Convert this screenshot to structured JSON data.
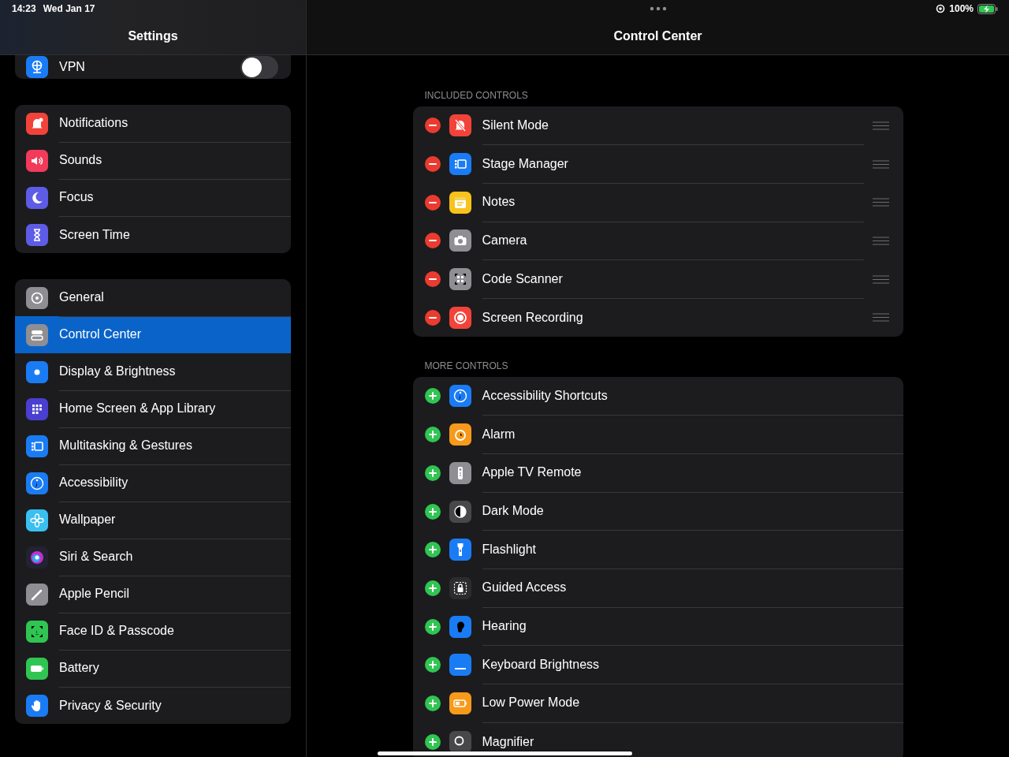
{
  "status_bar": {
    "time": "14:23",
    "date": "Wed Jan 17",
    "battery_percent": "100%",
    "charging": true
  },
  "sidebar": {
    "title": "Settings",
    "groups": [
      {
        "items": [
          {
            "label": "VPN",
            "color": "#1a7cf5",
            "kind": "toggle",
            "on": false,
            "selected": false
          }
        ]
      },
      {
        "items": [
          {
            "label": "Notifications",
            "color": "#f2433a",
            "kind": "link",
            "selected": false
          },
          {
            "label": "Sounds",
            "color": "#f23a5a",
            "kind": "link",
            "selected": false
          },
          {
            "label": "Focus",
            "color": "#5e5ce6",
            "kind": "link",
            "selected": false
          },
          {
            "label": "Screen Time",
            "color": "#5e5ce6",
            "kind": "link",
            "selected": false
          }
        ]
      },
      {
        "items": [
          {
            "label": "General",
            "color": "#8e8e93",
            "kind": "link",
            "selected": false
          },
          {
            "label": "Control Center",
            "color": "#8e8e93",
            "kind": "link",
            "selected": true
          },
          {
            "label": "Display & Brightness",
            "color": "#1a7cf5",
            "kind": "link",
            "selected": false
          },
          {
            "label": "Home Screen & App Library",
            "color": "#4a3fd0",
            "kind": "link",
            "selected": false
          },
          {
            "label": "Multitasking & Gestures",
            "color": "#1a7cf5",
            "kind": "link",
            "selected": false
          },
          {
            "label": "Accessibility",
            "color": "#1a7cf5",
            "kind": "link",
            "selected": false
          },
          {
            "label": "Wallpaper",
            "color": "#3ac0f0",
            "kind": "link",
            "selected": false
          },
          {
            "label": "Siri & Search",
            "color": "#222233",
            "kind": "link",
            "selected": false
          },
          {
            "label": "Apple Pencil",
            "color": "#8e8e93",
            "kind": "link",
            "selected": false
          },
          {
            "label": "Face ID & Passcode",
            "color": "#30c552",
            "kind": "link",
            "selected": false
          },
          {
            "label": "Battery",
            "color": "#30c552",
            "kind": "link",
            "selected": false
          },
          {
            "label": "Privacy & Security",
            "color": "#1a7cf5",
            "kind": "link",
            "selected": false
          }
        ]
      }
    ]
  },
  "detail": {
    "title": "Control Center",
    "sections": [
      {
        "header": "INCLUDED CONTROLS",
        "kind": "remove",
        "items": [
          {
            "label": "Silent Mode",
            "color": "#f2433a"
          },
          {
            "label": "Stage Manager",
            "color": "#1a7cf5"
          },
          {
            "label": "Notes",
            "color": "#f7c21b"
          },
          {
            "label": "Camera",
            "color": "#8e8e93"
          },
          {
            "label": "Code Scanner",
            "color": "#8e8e93"
          },
          {
            "label": "Screen Recording",
            "color": "#f2433a"
          }
        ]
      },
      {
        "header": "MORE CONTROLS",
        "kind": "add",
        "items": [
          {
            "label": "Accessibility Shortcuts",
            "color": "#1a7cf5"
          },
          {
            "label": "Alarm",
            "color": "#f79a1b"
          },
          {
            "label": "Apple TV Remote",
            "color": "#8e8e93"
          },
          {
            "label": "Dark Mode",
            "color": "#48484a"
          },
          {
            "label": "Flashlight",
            "color": "#1a7cf5"
          },
          {
            "label": "Guided Access",
            "color": "#2c2c2e"
          },
          {
            "label": "Hearing",
            "color": "#1a7cf5"
          },
          {
            "label": "Keyboard Brightness",
            "color": "#1a7cf5"
          },
          {
            "label": "Low Power Mode",
            "color": "#f79a1b"
          },
          {
            "label": "Magnifier",
            "color": "#48484a"
          }
        ]
      }
    ]
  }
}
